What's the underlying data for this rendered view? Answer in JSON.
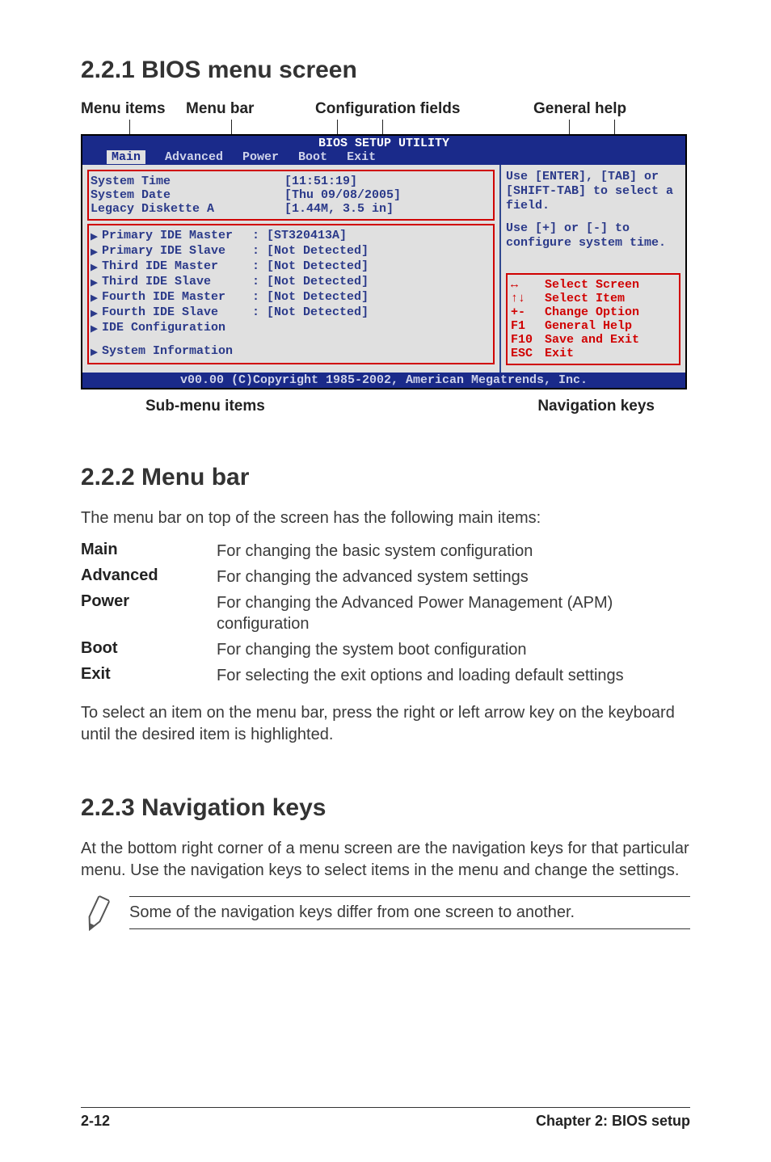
{
  "sections": {
    "s1_title": "2.2.1   BIOS menu screen",
    "s2_title": "2.2.2   Menu bar",
    "s3_title": "2.2.3   Navigation keys"
  },
  "labels": {
    "menu_items": "Menu items",
    "menu_bar": "Menu bar",
    "config_fields": "Configuration fields",
    "general_help": "General help",
    "sub_menu": "Sub-menu items",
    "nav_keys": "Navigation keys"
  },
  "bios": {
    "title": "BIOS SETUP UTILITY",
    "tabs": [
      "Main",
      "Advanced",
      "Power",
      "Boot",
      "Exit"
    ],
    "rows": {
      "system_time": {
        "k": "System Time",
        "v": "[11:51:19]"
      },
      "system_date": {
        "k": "System Date",
        "v": "[Thu 09/08/2005]"
      },
      "legacy": {
        "k": "Legacy Diskette A",
        "v": "[1.44M, 3.5 in]"
      }
    },
    "sub": [
      {
        "k": "Primary IDE Master",
        "v": ": [ST320413A]"
      },
      {
        "k": "Primary IDE Slave",
        "v": ": [Not Detected]"
      },
      {
        "k": "Third IDE Master",
        "v": ": [Not Detected]"
      },
      {
        "k": "Third IDE Slave",
        "v": ": [Not Detected]"
      },
      {
        "k": "Fourth IDE Master",
        "v": ": [Not Detected]"
      },
      {
        "k": "Fourth IDE Slave",
        "v": ": [Not Detected]"
      },
      {
        "k": "IDE Configuration",
        "v": ""
      }
    ],
    "sys_info": "System Information",
    "help1": "Use [ENTER], [TAB] or [SHIFT-TAB] to select a field.",
    "help2": "Use [+] or [-] to configure system time.",
    "nav": [
      {
        "k": "↔",
        "v": "Select Screen"
      },
      {
        "k": "↑↓",
        "v": "Select Item"
      },
      {
        "k": "+-",
        "v": "Change Option"
      },
      {
        "k": "F1",
        "v": "General Help"
      },
      {
        "k": "F10",
        "v": "Save and Exit"
      },
      {
        "k": "ESC",
        "v": "Exit"
      }
    ],
    "footer": "v00.00 (C)Copyright 1985-2002, American Megatrends, Inc."
  },
  "s2_intro": "The menu bar on top of the screen has the following main items:",
  "defs": [
    {
      "term": "Main",
      "desc": "For changing the basic system configuration"
    },
    {
      "term": "Advanced",
      "desc": "For changing the advanced system settings"
    },
    {
      "term": "Power",
      "desc": "For changing the Advanced Power Management (APM) configuration"
    },
    {
      "term": "Boot",
      "desc": "For changing the system boot configuration"
    },
    {
      "term": "Exit",
      "desc": "For selecting the exit options and loading default settings"
    }
  ],
  "s2_outro": "To select an item on the menu bar, press the right or left arrow key on the keyboard until the desired item is highlighted.",
  "s3_intro": "At the bottom right corner of a menu screen are the navigation keys for that particular menu. Use the navigation keys to select items in the menu and change the settings.",
  "note": "Some of the navigation keys differ from one screen to another.",
  "footer": {
    "page": "2-12",
    "chapter": "Chapter 2: BIOS setup"
  }
}
